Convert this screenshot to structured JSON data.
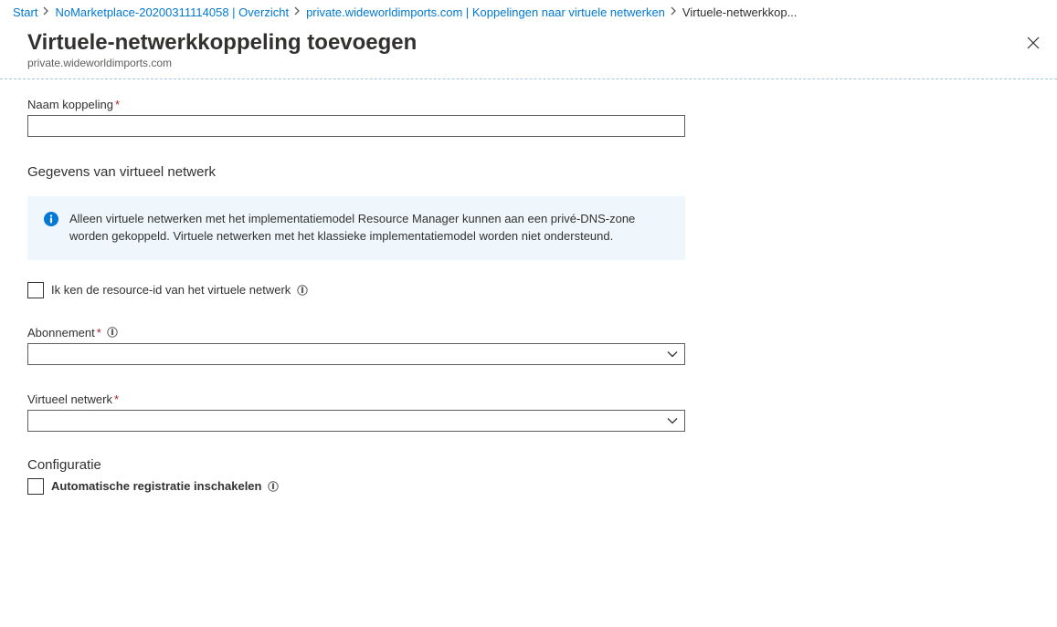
{
  "breadcrumb": {
    "items": [
      {
        "label": "Start",
        "link": true
      },
      {
        "label": "NoMarketplace-20200311114058 | Overzicht",
        "link": true
      },
      {
        "label": "private.wideworldimports.com | Koppelingen naar virtuele netwerken",
        "link": true
      },
      {
        "label": "Virtuele-netwerkkop...",
        "link": false
      }
    ]
  },
  "header": {
    "title": "Virtuele-netwerkkoppeling toevoegen",
    "subtitle": "private.wideworldimports.com"
  },
  "form": {
    "linkName": {
      "label": "Naam koppeling",
      "value": ""
    },
    "vnetDetailsTitle": "Gegevens van virtueel netwerk",
    "infoText": "Alleen virtuele netwerken met het implementatiemodel Resource Manager kunnen aan een privé-DNS-zone worden gekoppeld. Virtuele netwerken met het klassieke implementatiemodel worden niet ondersteund.",
    "knowResourceId": {
      "label": "Ik ken de resource-id van het virtuele netwerk",
      "checked": false
    },
    "subscription": {
      "label": "Abonnement",
      "value": ""
    },
    "virtualNetwork": {
      "label": "Virtueel netwerk",
      "value": ""
    },
    "configTitle": "Configuratie",
    "autoRegistration": {
      "label": "Automatische registratie inschakelen",
      "checked": false
    }
  }
}
